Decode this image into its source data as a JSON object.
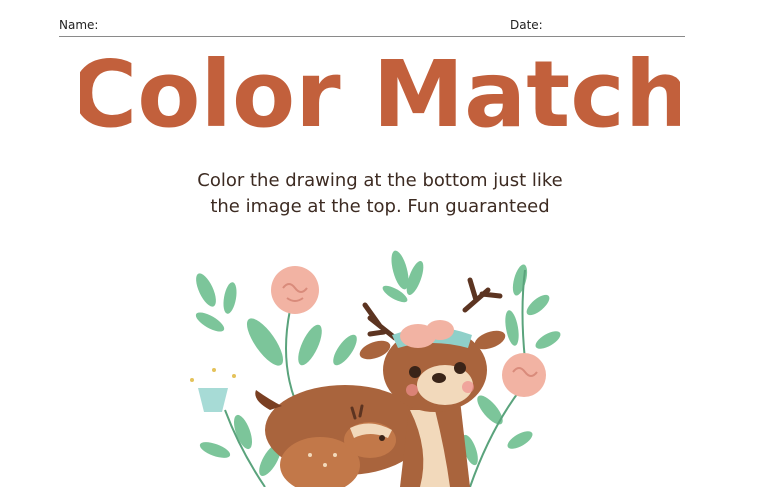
{
  "header": {
    "name_label": "Name:",
    "date_label": "Date:"
  },
  "title": "Color Match",
  "instructions": {
    "line1": "Color the drawing at the bottom just like",
    "line2": "the image at the top. Fun guaranteed"
  },
  "colors": {
    "title_fill": "#c2603c",
    "title_stroke": "#a84e2f",
    "deer_brown": "#a9643d",
    "deer_belly": "#f2d9bb",
    "antler": "#5c3421",
    "leaf_green": "#7cc59a",
    "flower_pink": "#f2b3a3",
    "flower_teal": "#a7dbd6",
    "band_teal": "#8fd0c9"
  },
  "illustration": {
    "subject": "mother deer with fawn among flowers",
    "icon": "deer-illustration"
  }
}
